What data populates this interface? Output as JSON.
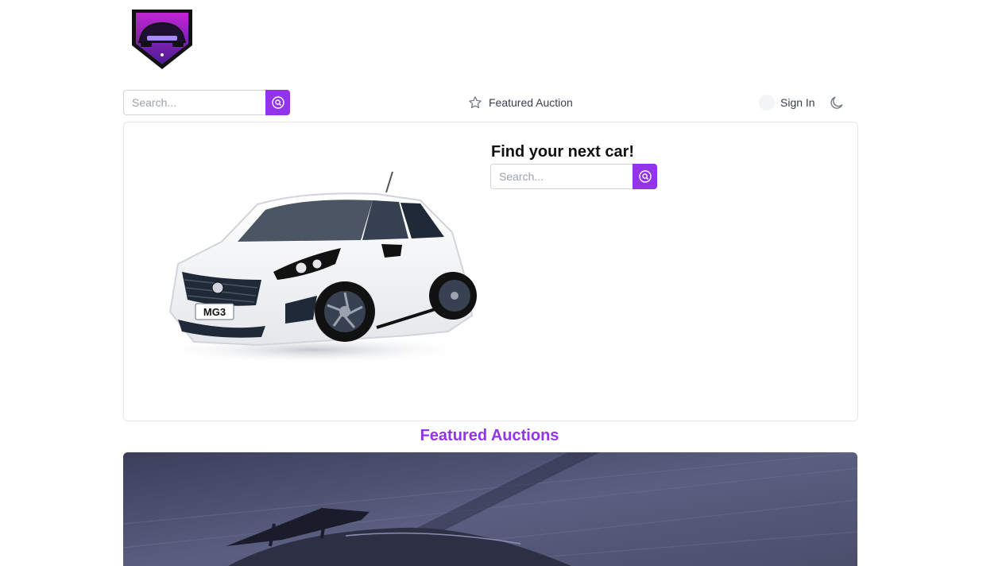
{
  "header": {
    "logo_icon": "car-shield-logo"
  },
  "nav": {
    "search_placeholder": "Search...",
    "search_icon": "search-circle-icon",
    "featured_label": "Featured Auction",
    "featured_icon": "star-icon",
    "signin_label": "Sign In",
    "theme_icon": "moon-icon"
  },
  "hero": {
    "title": "Find your next car!",
    "search_placeholder": "Search...",
    "plate_text": "MG3"
  },
  "featured": {
    "title": "Featured Auctions"
  },
  "colors": {
    "accent": "#9333ea",
    "border": "#e5e7eb"
  }
}
